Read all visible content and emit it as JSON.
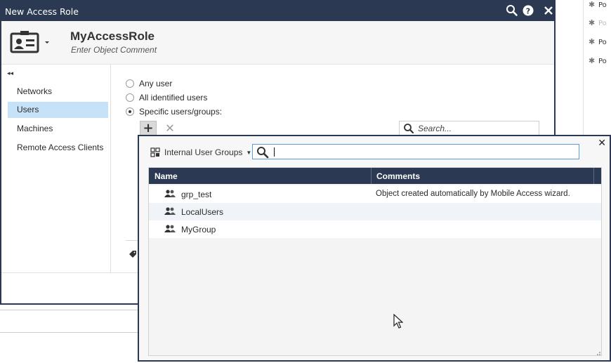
{
  "main_dialog": {
    "title": "New Access Role",
    "role_name": "MyAccessRole",
    "role_comment_placeholder": "Enter Object Comment"
  },
  "nav": {
    "items": [
      {
        "label": "Networks",
        "active": false
      },
      {
        "label": "Users",
        "active": true
      },
      {
        "label": "Machines",
        "active": false
      },
      {
        "label": "Remote Access Clients",
        "active": false
      }
    ]
  },
  "users_pane": {
    "options": [
      {
        "label": "Any user",
        "checked": false
      },
      {
        "label": "All identified users",
        "checked": false
      },
      {
        "label": "Specific users/groups:",
        "checked": true
      }
    ],
    "add_label": "+",
    "remove_label": "✕",
    "search_placeholder": "Search..."
  },
  "picker": {
    "filter_label": "Internal User Groups",
    "close_label": "✕",
    "search_value": "",
    "columns": {
      "name": "Name",
      "comments": "Comments"
    },
    "rows": [
      {
        "name": "grp_test",
        "comment": "Object created automatically by Mobile Access wizard."
      },
      {
        "name": "LocalUsers",
        "comment": ""
      },
      {
        "name": "MyGroup",
        "comment": ""
      }
    ]
  },
  "background": {
    "rows": [
      "Po",
      "Po",
      "Po",
      "Po"
    ]
  },
  "colors": {
    "titlebar": "#2b3a52",
    "nav_active": "#c6e2f9",
    "search_focus": "#5aa0dc"
  },
  "icons": [
    "search-icon",
    "help-icon",
    "close-icon",
    "user-card-icon",
    "group-icon",
    "tag-icon",
    "collapse-icon",
    "mouse-cursor-icon"
  ]
}
